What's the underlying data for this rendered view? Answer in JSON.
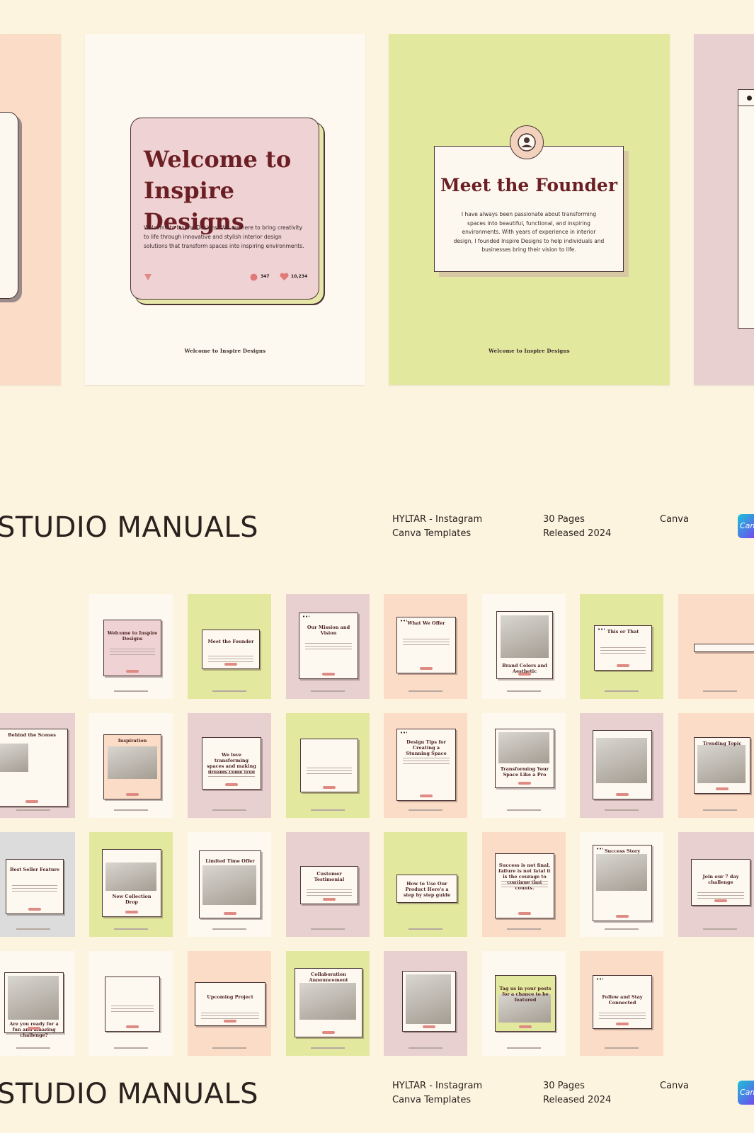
{
  "colors": {
    "background": "#fdf4df",
    "pink": "#efd2d3",
    "lime": "#e3e89f",
    "mauve": "#e8d0d0",
    "peach": "#fbdcc6",
    "cream": "#fdf9f1",
    "maroon": "#6b1f24"
  },
  "hero": {
    "welcome": {
      "title": "Welcome to Inspire Designs",
      "body": "Welcome to Inspire Designs! We are here to bring creativity to life through innovative and stylish interior design solutions that transform spaces into inspiring environments.",
      "comments": "347",
      "likes": "10,234",
      "footer": "Welcome to Inspire Designs",
      "icons": [
        "send-icon",
        "comment-icon",
        "heart-icon"
      ]
    },
    "founder": {
      "title": "Meet the Founder",
      "body": "I have always been passionate about transforming spaces into beautiful, functional, and inspiring environments. With years of experience in interior design, I founded Inspire Designs to help individuals and businesses bring their vision to life.",
      "footer": "Welcome to Inspire Designs",
      "icons": [
        "user-icon"
      ]
    }
  },
  "product": {
    "name": "STUDIO MANUALS",
    "line1": "HYLTAR - Instagram",
    "line2": "Canva Templates",
    "pages": "30 Pages",
    "released": "Released 2024",
    "platform": "Canva",
    "badge": "Can"
  },
  "thumbnails": [
    {
      "title": "Welcome to Inspire Designs"
    },
    {
      "title": "Meet the Founder"
    },
    {
      "title": "Our Mission and Vision"
    },
    {
      "title": "What We Offer"
    },
    {
      "title": "Brand Colors and Aesthetic"
    },
    {
      "title": "This or That"
    },
    {
      "title": ""
    },
    {
      "title": "Behind the Scenes"
    },
    {
      "title": "Inspiration"
    },
    {
      "title": "We love transforming spaces and making dreams come true"
    },
    {
      "title": ""
    },
    {
      "title": "Design Tips for Creating a Stunning Space"
    },
    {
      "title": "Transforming Your Space Like a Pro"
    },
    {
      "title": ""
    },
    {
      "title": "Trending Topic"
    },
    {
      "title": "Best Seller Feature"
    },
    {
      "title": "New Collection Drop"
    },
    {
      "title": "Limited Time Offer"
    },
    {
      "title": "Customer Testimonial"
    },
    {
      "title": "How to Use Our Product Here's a step by step guide"
    },
    {
      "title": "Success is not final, failure is not fatal it is the courage to continue that counts."
    },
    {
      "title": "Success Story"
    },
    {
      "title": "Join our 7 day challenge"
    },
    {
      "title": "Are you ready for a fun and amazing challenge?"
    },
    {
      "title": ""
    },
    {
      "title": "Upcoming Project"
    },
    {
      "title": "Collaboration Announcement"
    },
    {
      "title": ""
    },
    {
      "title": "Tag us in your posts for a chance to be featured"
    },
    {
      "title": "Follow and Stay Connected"
    }
  ]
}
